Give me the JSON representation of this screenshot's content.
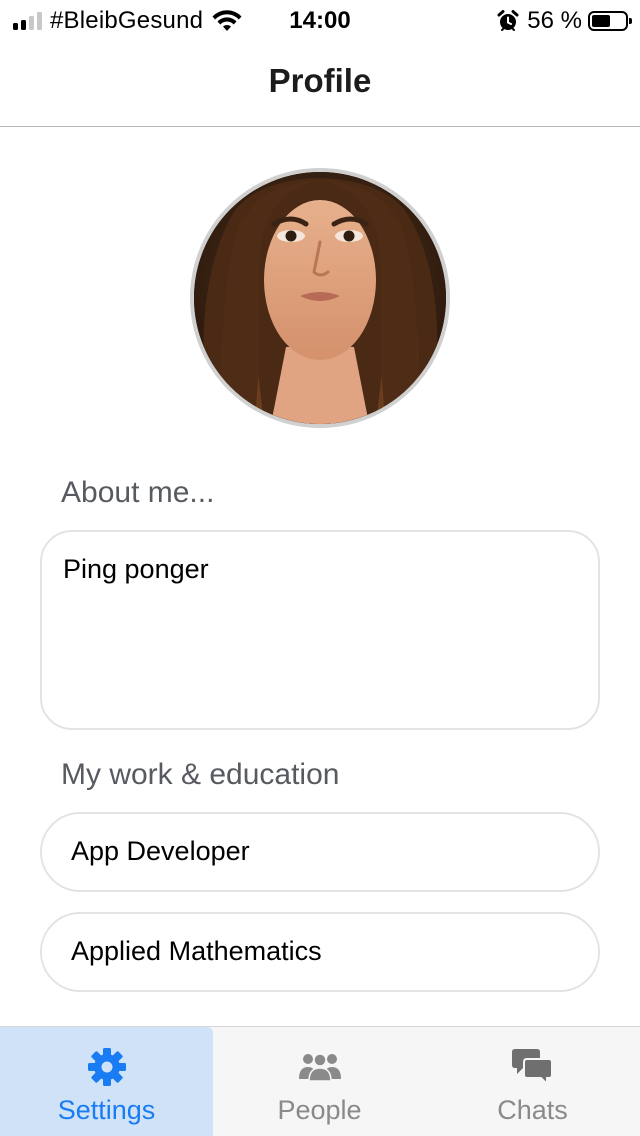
{
  "status_bar": {
    "carrier": "#BleibGesund",
    "time": "14:00",
    "battery_percent": "56 %",
    "battery_level": 0.56,
    "icons": [
      "signal-icon",
      "wifi-icon",
      "alarm-icon",
      "battery-icon"
    ]
  },
  "nav": {
    "title": "Profile"
  },
  "profile": {
    "avatar": "profile-photo"
  },
  "about": {
    "label": "About me...",
    "value": "Ping ponger"
  },
  "work": {
    "label": "My work & education",
    "items": [
      {
        "value": "App Developer"
      },
      {
        "value": "Applied Mathematics"
      }
    ]
  },
  "tabs": [
    {
      "label": "Settings",
      "icon": "gear-icon",
      "active": true
    },
    {
      "label": "People",
      "icon": "people-icon",
      "active": false
    },
    {
      "label": "Chats",
      "icon": "chat-bubbles-icon",
      "active": false
    }
  ],
  "colors": {
    "accent": "#1a7cf2",
    "active_tab_bg": "#cfe2f8",
    "inactive_tab": "#8a8a8a",
    "section_label": "#575a61",
    "field_border": "#e3e3e3"
  }
}
